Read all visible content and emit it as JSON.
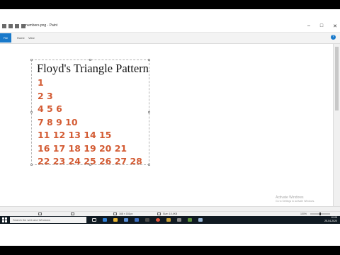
{
  "window": {
    "title": "numbers.png - Paint"
  },
  "ribbon": {
    "file_tab": "File",
    "tabs": [
      "Home",
      "View"
    ]
  },
  "image": {
    "title": "Floyd's Triangle Pattern",
    "rows": [
      "1",
      "2 3",
      "4 5 6",
      "7 8 9 10",
      "11 12 13 14 15",
      "16 17 18 19 20 21",
      "22 23 24 25 26 27 28"
    ]
  },
  "statusbar": {
    "dimensions": "168 × 151px",
    "size": "Size: 10.4KB",
    "zoom": "100%"
  },
  "watermark": {
    "line1": "Activate Windows",
    "line2": "Go to Settings to activate Windows."
  },
  "taskbar": {
    "search_placeholder": "Search the web and Windows",
    "time": "10:05",
    "date": "25-04-2020"
  },
  "colors": {
    "number_color": "#d35b33",
    "accent": "#1979ca"
  },
  "icons": [
    "windows-start-icon",
    "task-view-icon",
    "edge-icon",
    "file-explorer-icon",
    "store-icon",
    "mail-icon",
    "paint-icon",
    "chrome-icon",
    "media-player-icon"
  ]
}
